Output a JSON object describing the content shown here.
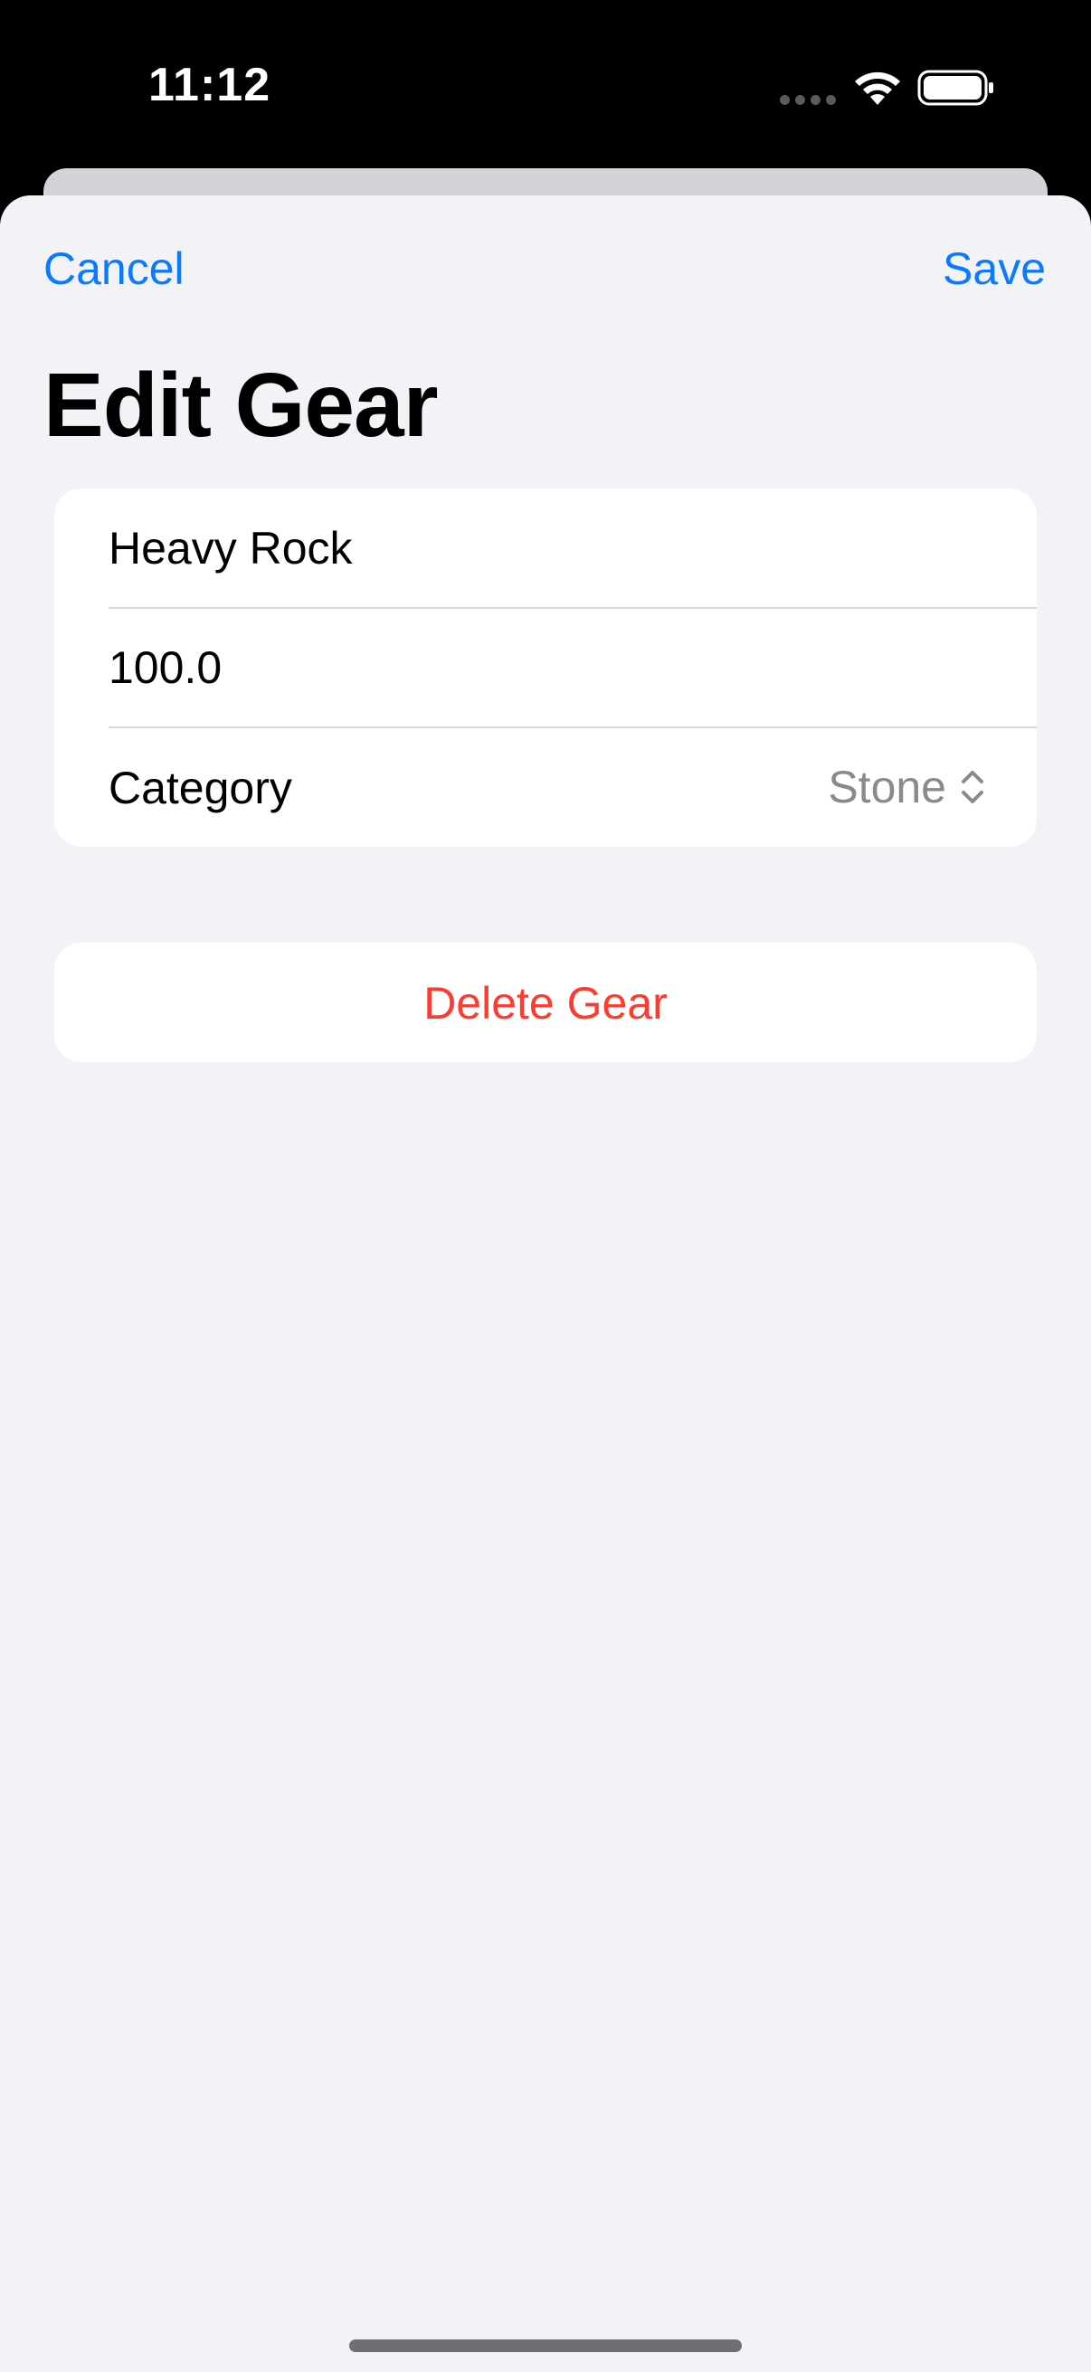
{
  "status_bar": {
    "time": "11:12",
    "wifi_icon": "wifi-icon",
    "battery_icon": "battery-full-icon"
  },
  "nav": {
    "cancel_label": "Cancel",
    "save_label": "Save",
    "accent_color": "#0a7aff"
  },
  "title": "Edit Gear",
  "form": {
    "name_value": "Heavy Rock",
    "weight_value": "100.0",
    "category_label": "Category",
    "category_value": "Stone",
    "picker_icon": "chevron-up-down-icon"
  },
  "delete_label": "Delete Gear",
  "destructive_color": "#ff3b30"
}
